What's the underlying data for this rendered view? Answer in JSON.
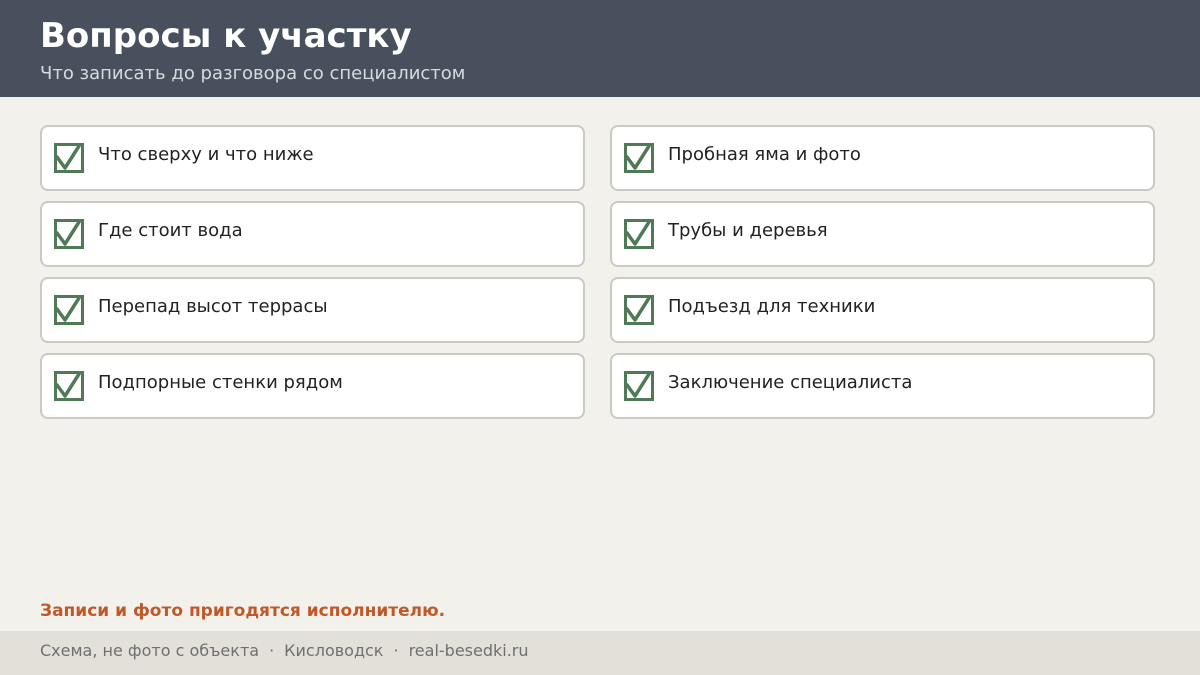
{
  "header": {
    "title": "Вопросы к участку",
    "subtitle": "Что записать до разговора со специалистом"
  },
  "checklist": {
    "left": [
      {
        "label": "Что сверху и что ниже",
        "checked": true
      },
      {
        "label": "Где стоит вода",
        "checked": true
      },
      {
        "label": "Перепад высот террасы",
        "checked": true
      },
      {
        "label": "Подпорные стенки рядом",
        "checked": true
      }
    ],
    "right": [
      {
        "label": "Пробная яма и фото",
        "checked": true
      },
      {
        "label": "Трубы и деревья",
        "checked": true
      },
      {
        "label": "Подъезд для техники",
        "checked": true
      },
      {
        "label": "Заключение специалиста",
        "checked": true
      }
    ]
  },
  "note": "Записи и фото пригодятся исполнителю.",
  "footer": {
    "caption": "Схема, не фото с объекта",
    "separator": "·",
    "city": "Кисловодск",
    "site": "real-besedki.ru"
  },
  "colors": {
    "header_bg": "#47505c",
    "check_green": "#4f7a55",
    "note_accent": "#c0592a"
  },
  "icons": {
    "checkbox": "checkbox-checked-icon"
  }
}
